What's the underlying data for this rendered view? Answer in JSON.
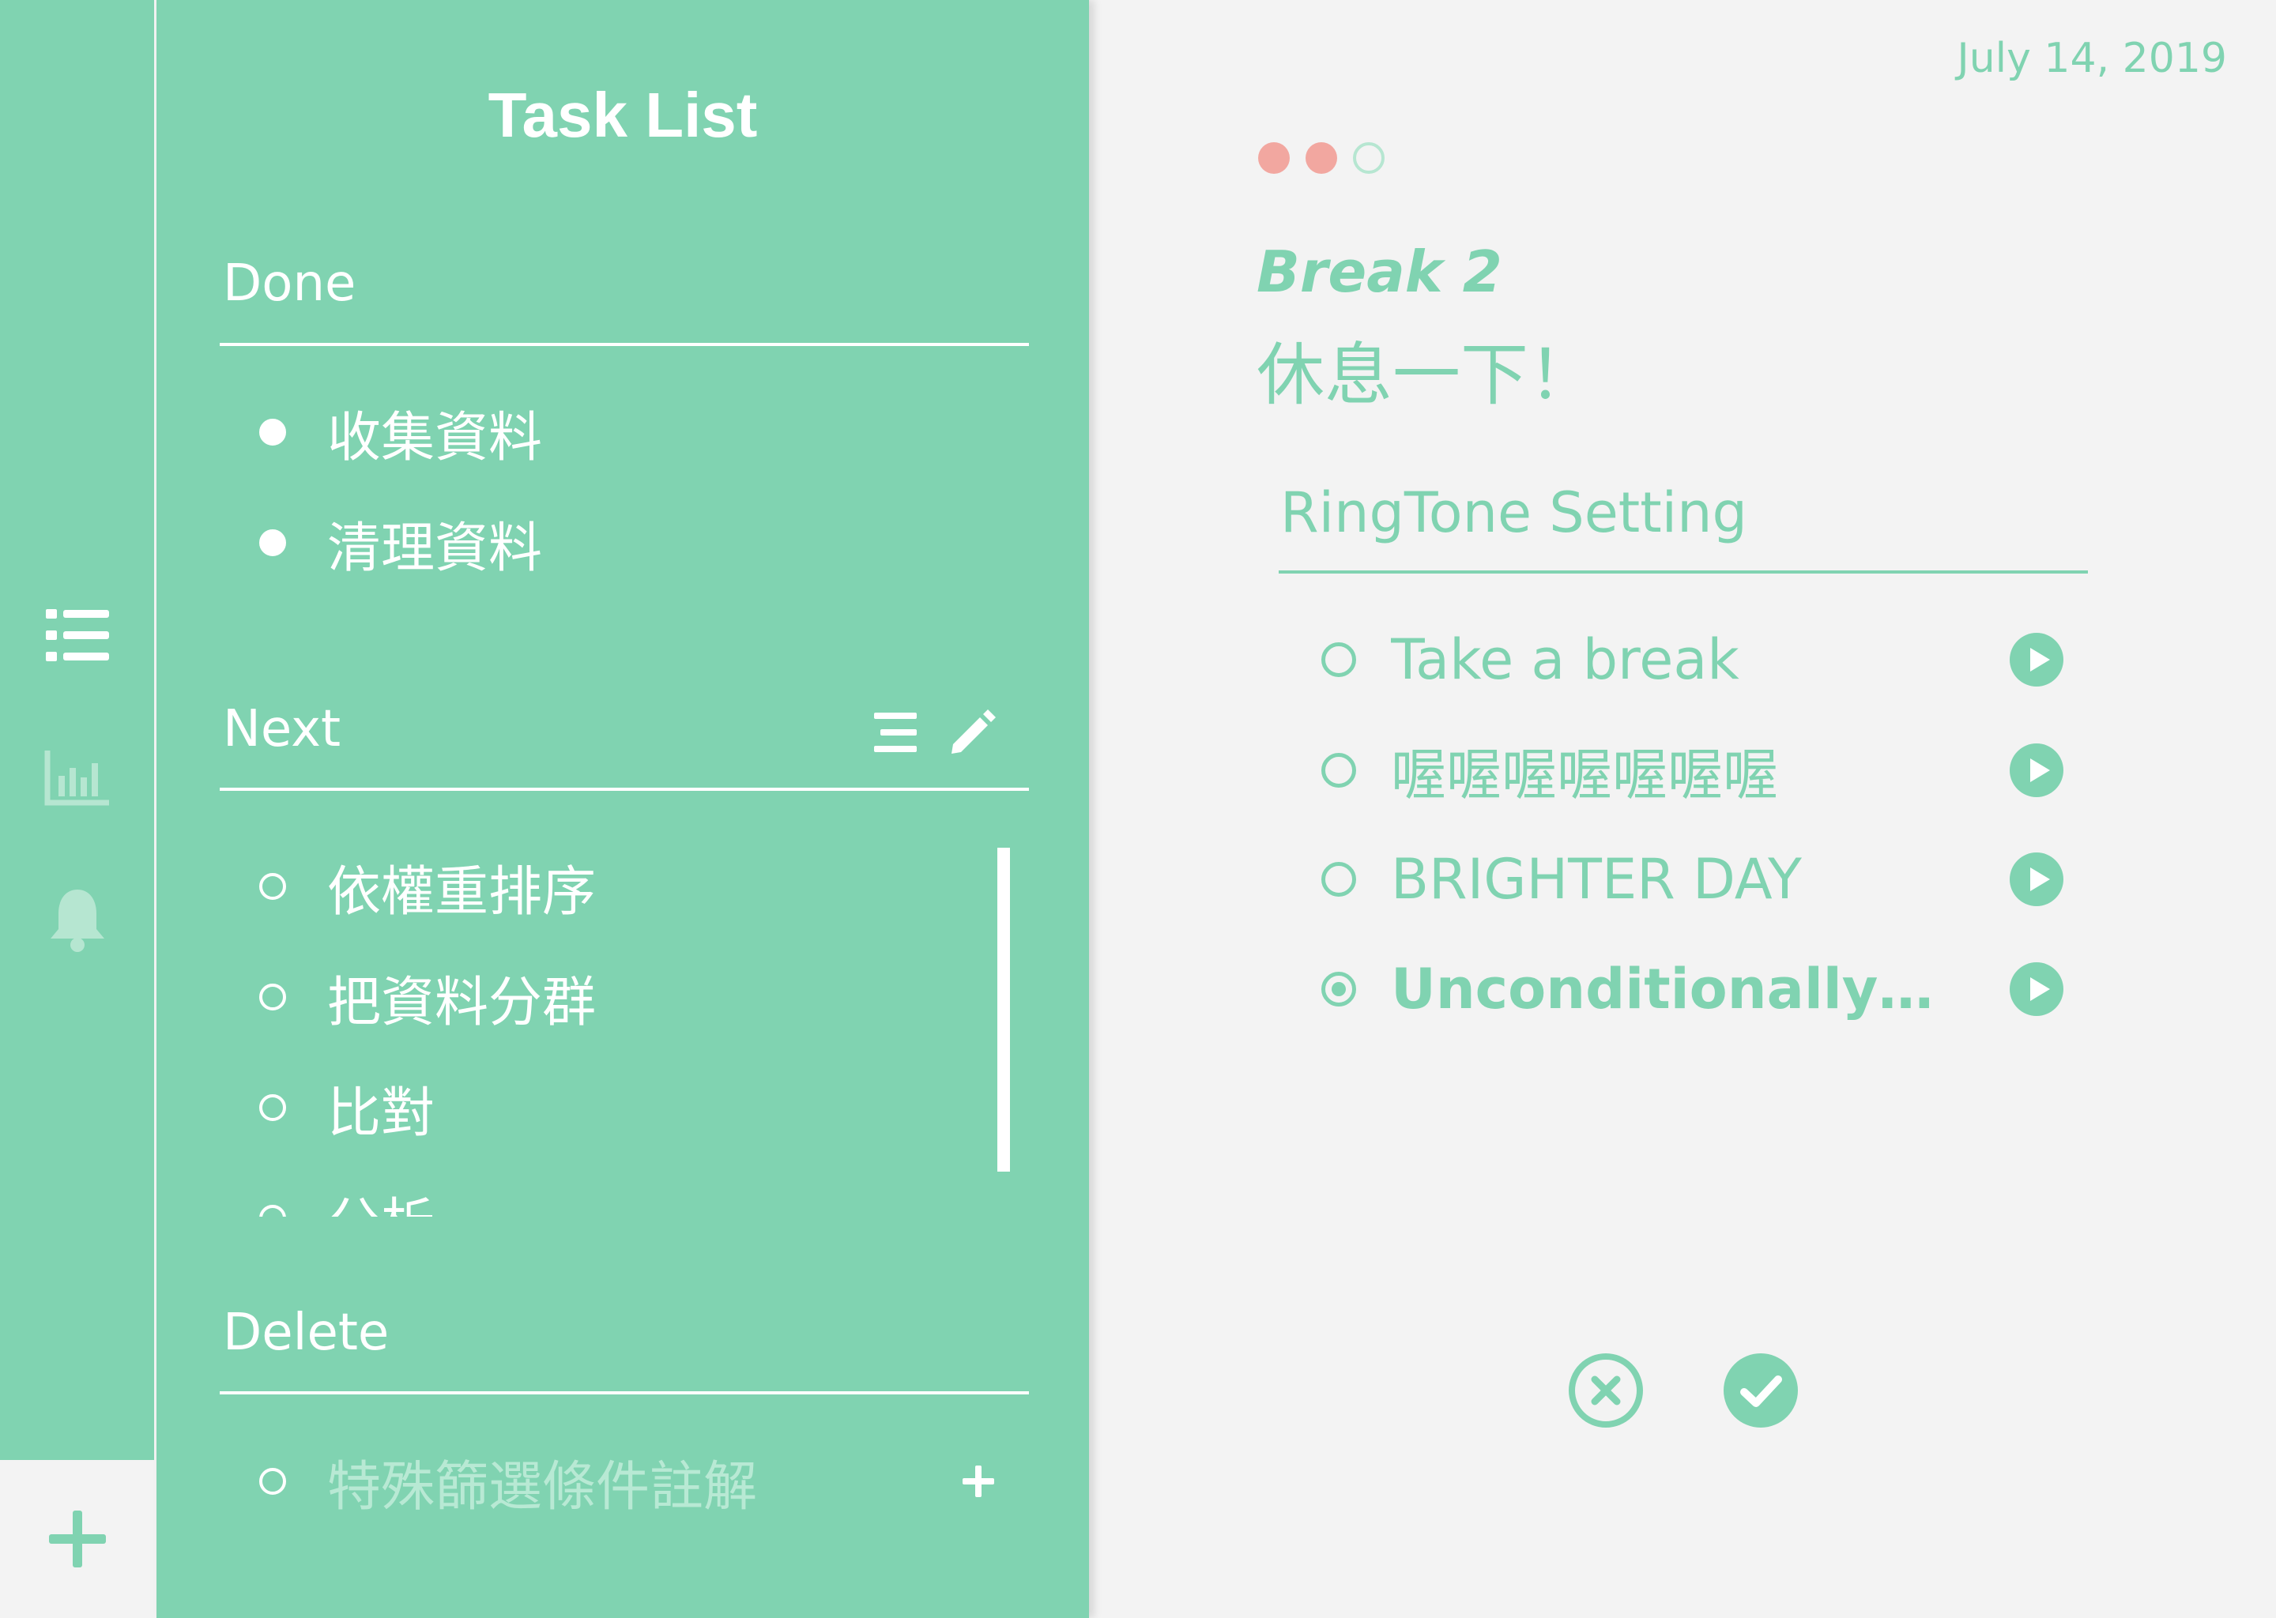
{
  "colors": {
    "accent": "#80d3b1",
    "background": "#f3f3f3",
    "white": "#ffffff",
    "page_dot_active": "#f2a7a0"
  },
  "rail": {
    "items": [
      {
        "icon": "list-icon"
      },
      {
        "icon": "bar-chart-icon"
      },
      {
        "icon": "bell-icon"
      }
    ],
    "add_icon": "plus-icon"
  },
  "tasklist": {
    "title": "Task List",
    "done": {
      "title": "Done",
      "items": [
        "收集資料",
        "清理資料"
      ]
    },
    "next": {
      "title": "Next",
      "tools": [
        "sort-icon",
        "pencil-icon"
      ],
      "items": [
        "依權重排序",
        "把資料分群",
        "比對",
        "分析"
      ]
    },
    "delete": {
      "title": "Delete",
      "placeholder": "特殊篩選條件註解",
      "add_icon": "plus-icon"
    }
  },
  "detail": {
    "date": "July 14, 2019",
    "pager": {
      "total": 3,
      "active": 2
    },
    "break_title": "Break 2",
    "break_subtitle": "休息一下！",
    "ringtone": {
      "title": "RingTone Setting",
      "options": [
        {
          "label": "Take a break",
          "selected": false
        },
        {
          "label": "喔喔喔喔喔喔喔",
          "selected": false
        },
        {
          "label": "BRIGHTER DAY",
          "selected": false
        },
        {
          "label": "Unconditionally-K...",
          "selected": true
        }
      ]
    },
    "actions": {
      "cancel_icon": "close-circle-icon",
      "confirm_icon": "check-circle-icon"
    }
  }
}
